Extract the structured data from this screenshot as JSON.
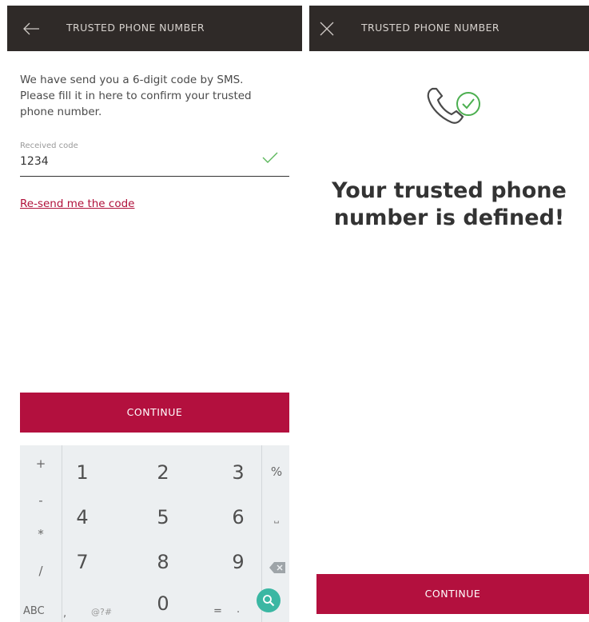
{
  "left": {
    "header": {
      "title": "TRUSTED PHONE NUMBER",
      "icon": "back-arrow-icon"
    },
    "instructions": "We have send you a 6-digit code by SMS. Please fill it in here to confirm your trusted phone number.",
    "code_field": {
      "label": "Received code",
      "value": "1234",
      "status_icon": "check-icon"
    },
    "resend_link": "Re-send me the code",
    "continue_label": "CONTINUE",
    "keypad": {
      "symbols_left": [
        "+",
        "-",
        "*",
        "/"
      ],
      "digits": [
        "1",
        "2",
        "3",
        "4",
        "5",
        "6",
        "7",
        "8",
        "9",
        "0"
      ],
      "symbols_right": [
        "%",
        "⎵",
        "⌫"
      ],
      "bottom_left": "ABC",
      "bottom_comma": ",",
      "bottom_symbols": "@?#",
      "bottom_equals": "=",
      "bottom_dot": ".",
      "search_icon": "search-icon"
    }
  },
  "right": {
    "header": {
      "title": "TRUSTED PHONE NUMBER",
      "icon": "close-icon"
    },
    "illustration_icon": "phone-check-icon",
    "success_message": "Your trusted phone number is defined!",
    "continue_label": "CONTINUE"
  },
  "colors": {
    "header_bg": "#2f2a28",
    "accent": "#b3103e",
    "success_green": "#4caf50",
    "keypad_bg": "#eceff1",
    "search_key": "#3bb7a3"
  }
}
